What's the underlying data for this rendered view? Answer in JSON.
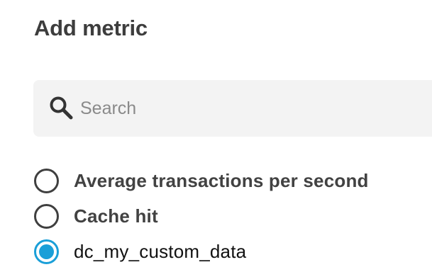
{
  "dialog": {
    "title": "Add metric"
  },
  "search": {
    "icon": "search-icon",
    "placeholder": "Search",
    "value": ""
  },
  "metrics": [
    {
      "label": "Average transactions per second",
      "selected": false
    },
    {
      "label": "Cache hit",
      "selected": false
    },
    {
      "label": "dc_my_custom_data",
      "selected": true
    }
  ],
  "colors": {
    "accent": "#1a9fd8",
    "search_background": "#f3f3f3",
    "text": "#424242"
  }
}
